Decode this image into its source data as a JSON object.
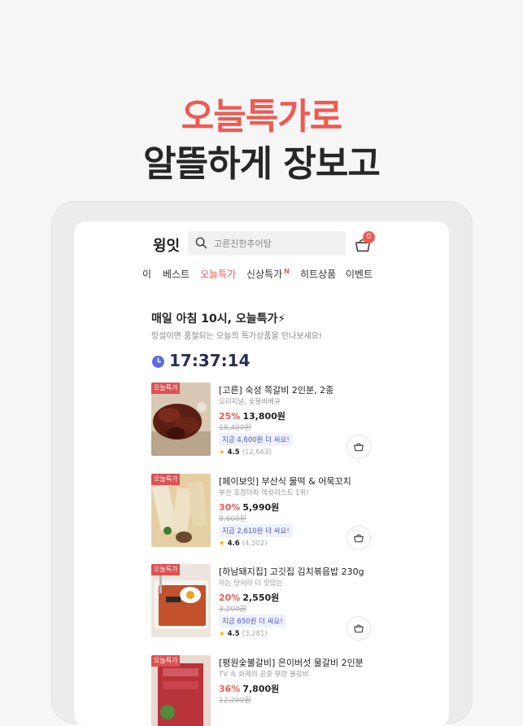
{
  "hero": {
    "line1": "오늘특가로",
    "line2": "알뜰하게 장보고"
  },
  "header": {
    "logo": "윙잇",
    "search_placeholder": "고른진한추어탕",
    "cart_count": "0"
  },
  "tabs": [
    {
      "label": "이"
    },
    {
      "label": "베스트"
    },
    {
      "label": "오늘특가",
      "active": true
    },
    {
      "label": "신상특가",
      "badge": "N"
    },
    {
      "label": "히트상품"
    },
    {
      "label": "이벤트"
    }
  ],
  "section": {
    "title": "매일 아침 10시, 오늘특가⚡",
    "subtitle": "망설이면 품절되는 오늘의 특가상품을 만나보세요!",
    "timer": "17:37:14"
  },
  "tag_label": "오늘특가",
  "products": [
    {
      "name": "[고른] 숙성 쪽갈비 2인분, 2종",
      "desc": "오리지널, 숯불바베큐",
      "rate": "25%",
      "price": "13,800원",
      "original": "18,400원",
      "save": "지금 4,600원 더 싸요!",
      "rating": "4.5",
      "reviews": "(12,663)"
    },
    {
      "name": "[페이보잇] 부산식 물떡 & 어묵꼬치",
      "desc": "부산 포장마차 먹킷리스트 1위!",
      "rate": "30%",
      "price": "5,990원",
      "original": "8,600원",
      "save": "지금 2,610원 더 싸요!",
      "rating": "4.6",
      "reviews": "(4,302)"
    },
    {
      "name": "[하남돼지집] 고깃집 김치볶음밥 230g",
      "desc": "아는 맛이라 더 맛있는",
      "rate": "20%",
      "price": "2,550원",
      "original": "3,200원",
      "save": "지금 650원 더 싸요!",
      "rating": "4.5",
      "reviews": "(3,281)"
    },
    {
      "name": "[평원숯불갈비] 은이버섯 물갈비 2인분",
      "desc": "TV 속 화제의 공중 부양 물갈비",
      "rate": "36%",
      "price": "7,800원",
      "original": "12,200원"
    }
  ],
  "colors": {
    "accent": "#ef5a52",
    "timer": "#2a2f54",
    "save_text": "#4a5bd1"
  }
}
